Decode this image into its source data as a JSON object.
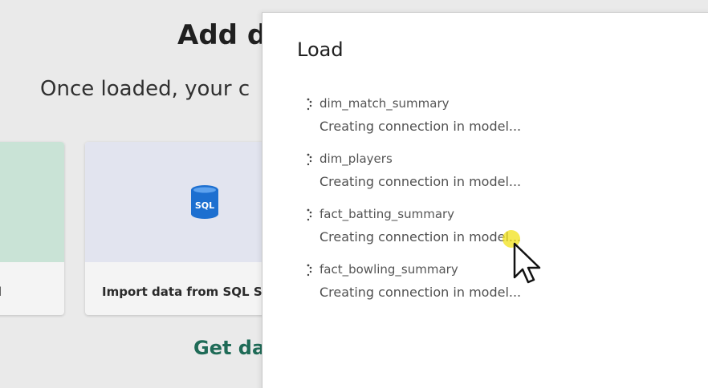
{
  "background": {
    "title": "Add d",
    "subtitle": "Once loaded, your c",
    "left_card_label": "l",
    "sql_card": {
      "icon_text": "SQL",
      "label": "Import data from SQL S"
    },
    "link_text": "Get dat"
  },
  "load_panel": {
    "title": "Load",
    "items": [
      {
        "name": "dim_match_summary",
        "status": "Creating connection in model..."
      },
      {
        "name": "dim_players",
        "status": "Creating connection in model..."
      },
      {
        "name": "fact_batting_summary",
        "status": "Creating connection in model..."
      },
      {
        "name": "fact_bowling_summary",
        "status": "Creating connection in model..."
      }
    ]
  },
  "colors": {
    "accent_green": "#1f6b57",
    "db_icon_blue": "#1d6fd0",
    "cursor_highlight": "#f2e21a"
  }
}
